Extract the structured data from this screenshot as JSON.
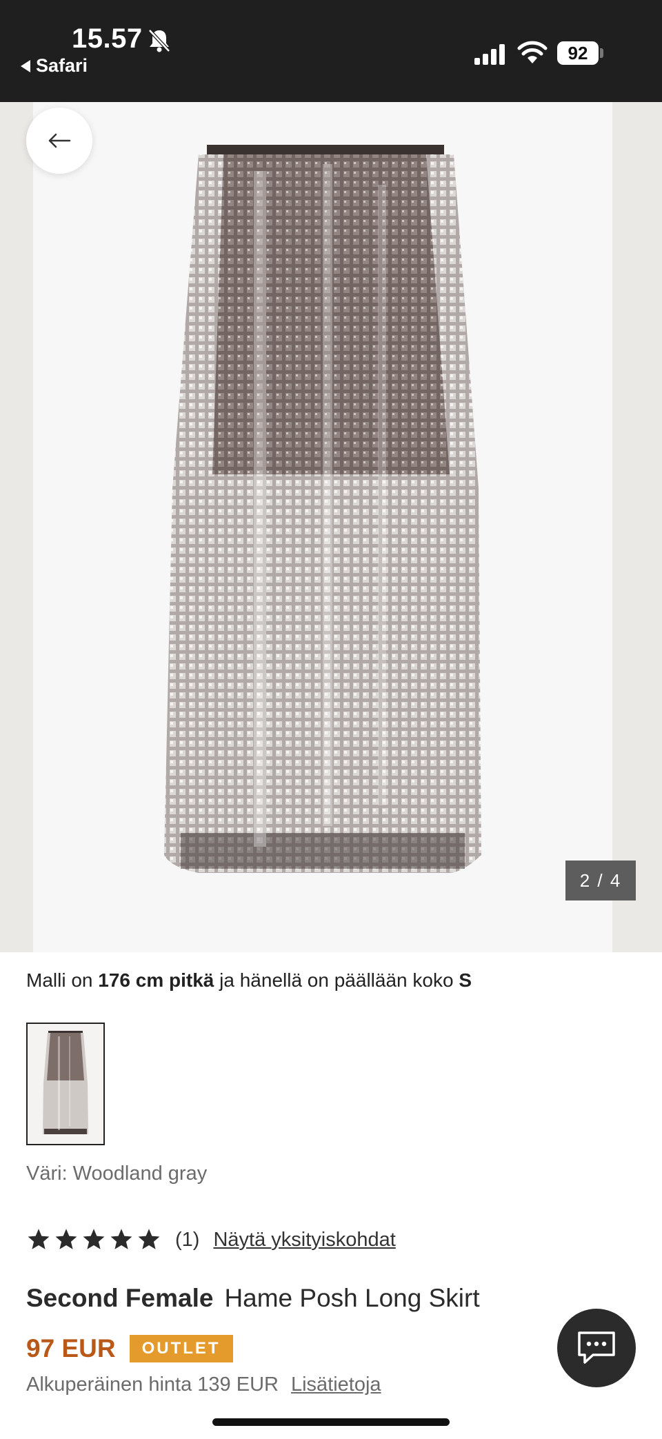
{
  "status_bar": {
    "time": "15.57",
    "back_app": "Safari",
    "battery": "92"
  },
  "gallery": {
    "counter": "2 / 4",
    "colors": {
      "skirt": "#8a7f7b",
      "background": "#f7f7f7"
    }
  },
  "model_info": {
    "prefix": "Malli on ",
    "height": "176 cm pitkä",
    "middle": " ja hänellä on päällään koko ",
    "size": "S"
  },
  "color": {
    "label": "Väri: Woodland gray"
  },
  "rating": {
    "stars": 5,
    "count": "(1)",
    "details_link": "Näytä yksityiskohdat"
  },
  "product": {
    "brand": "Second Female",
    "name": "Hame Posh Long Skirt",
    "price": "97 EUR",
    "badge": "OUTLET",
    "original_price": "Alkuperäinen hinta 139 EUR",
    "more_link": "Lisätietoja"
  },
  "theme": {
    "price_color": "#b8591a",
    "badge_color": "#e59a2c"
  }
}
